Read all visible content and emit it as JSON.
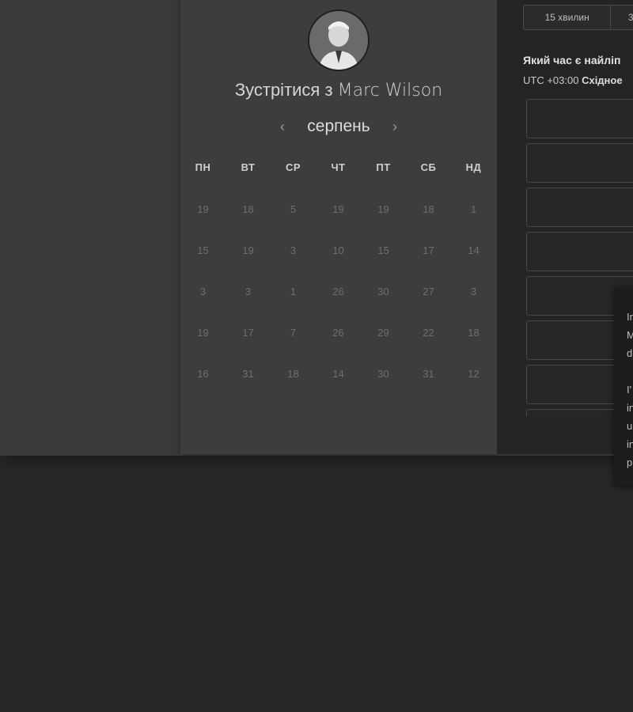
{
  "card": {
    "title_prefix": "Зустрітися з",
    "host_name": "Marc Wilson",
    "month": "серпень",
    "prev_arrow": "‹",
    "next_arrow": "›",
    "weekdays": [
      "ПН",
      "ВТ",
      "СР",
      "ЧТ",
      "ПТ",
      "СБ",
      "НД"
    ],
    "days": [
      [
        "19",
        "18",
        "5",
        "19",
        "19",
        "18",
        "1"
      ],
      [
        "15",
        "19",
        "3",
        "10",
        "15",
        "17",
        "14"
      ],
      [
        "3",
        "3",
        "1",
        "26",
        "30",
        "27",
        "3"
      ],
      [
        "19",
        "17",
        "7",
        "26",
        "29",
        "22",
        "18"
      ],
      [
        "16",
        "31",
        "18",
        "14",
        "30",
        "31",
        "12"
      ]
    ]
  },
  "scheduler": {
    "durations": [
      "15 хвилин",
      "3"
    ],
    "question": "Який час є найліп",
    "tz_prefix": "UTC +03:00",
    "tz_region": "Східное"
  },
  "popup": {
    "lines": [
      "In",
      "M",
      "d",
      "",
      "I'",
      "in",
      "u",
      "in",
      "p"
    ]
  },
  "colors": {
    "page_bg": "#272727",
    "card_bg": "#3d3d3d",
    "panel_bg": "#242424"
  },
  "icons": {
    "avatar": "user-photo"
  }
}
